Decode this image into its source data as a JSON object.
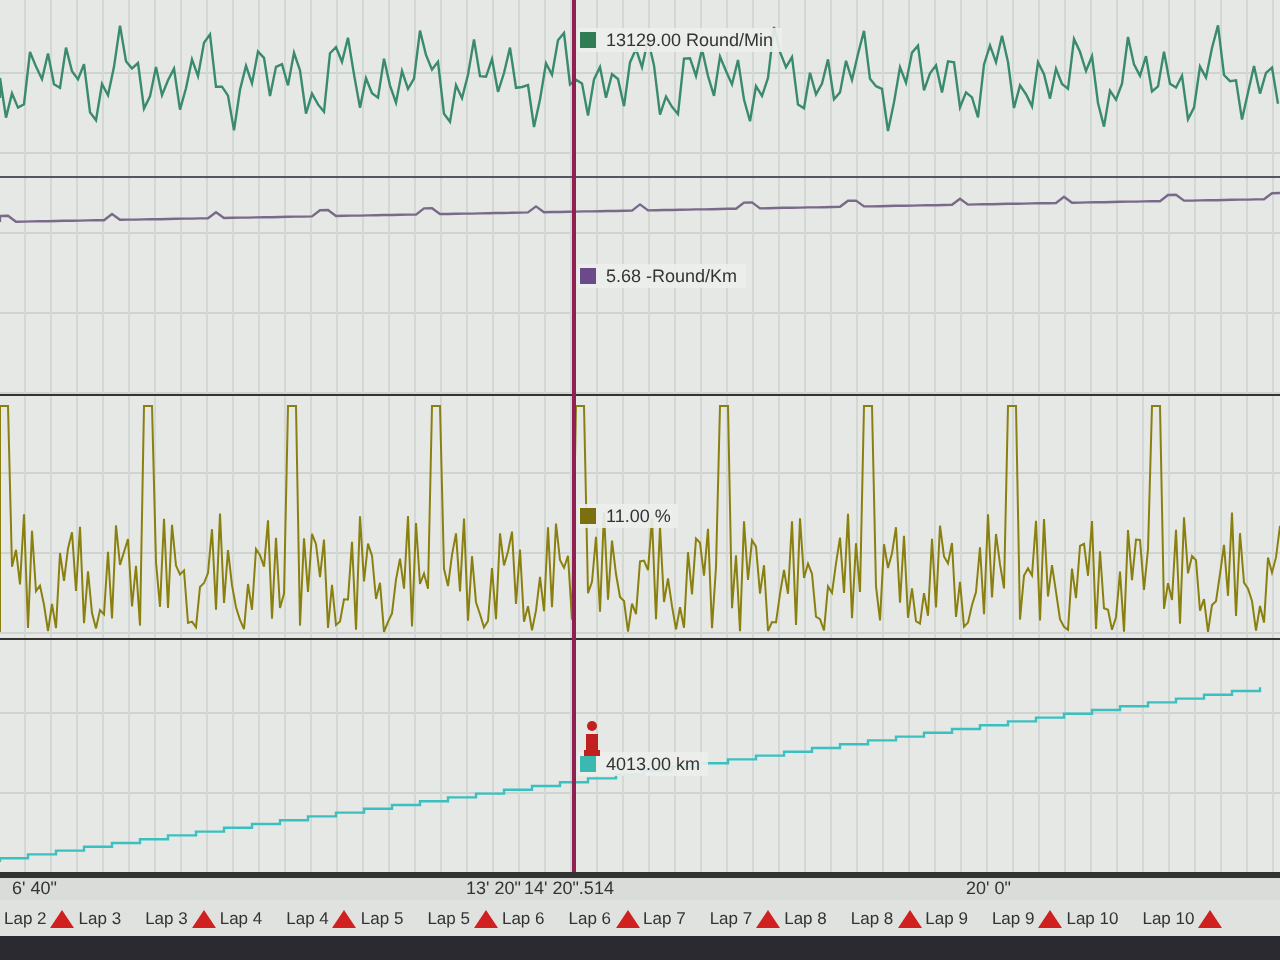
{
  "readouts": [
    {
      "value": "13129.00 Round/Min",
      "color": "#2e7d55"
    },
    {
      "value": "5.68 -Round/Km",
      "color": "#6a4a8a"
    },
    {
      "value": "11.00 %",
      "color": "#7a7010"
    },
    {
      "value": "4013.00 km",
      "color": "#3bb8b0"
    }
  ],
  "time_axis": [
    "6' 40\"",
    "13' 20\"",
    "14' 20\".514",
    "20' 0\""
  ],
  "laps": [
    {
      "from": "Lap 2",
      "to": "Lap 3"
    },
    {
      "from": "Lap 3",
      "to": "Lap 4"
    },
    {
      "from": "Lap 4",
      "to": "Lap 5"
    },
    {
      "from": "Lap 5",
      "to": "Lap 6"
    },
    {
      "from": "Lap 6",
      "to": "Lap 7"
    },
    {
      "from": "Lap 7",
      "to": "Lap 8"
    },
    {
      "from": "Lap 8",
      "to": "Lap 9"
    },
    {
      "from": "Lap 9",
      "to": "Lap 10"
    },
    {
      "from": "Lap 10"
    }
  ]
}
